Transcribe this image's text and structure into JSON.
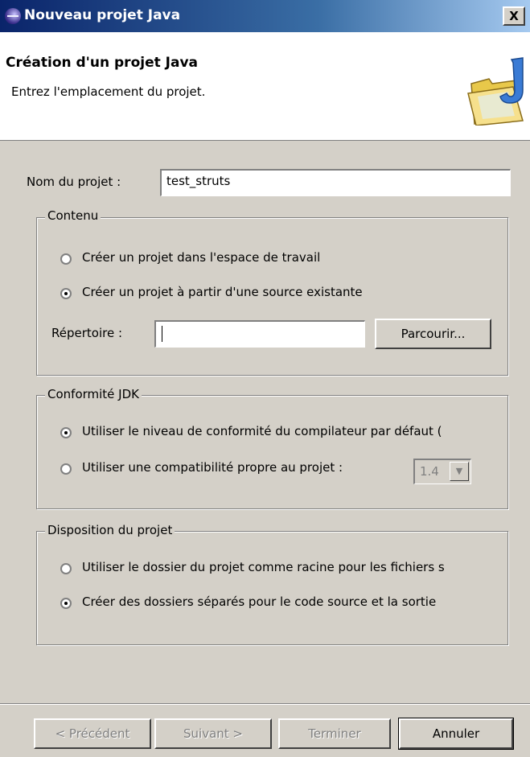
{
  "window": {
    "title": "Nouveau projet Java",
    "close_label": "X"
  },
  "banner": {
    "title": "Création d'un projet Java",
    "description": "Entrez l'emplacement du projet."
  },
  "project_name": {
    "label": "Nom du projet :",
    "value": "test_struts"
  },
  "content_group": {
    "title": "Contenu",
    "option_workspace": "Créer un projet dans l'espace de travail",
    "option_existing": "Créer un projet à partir d'une source existante",
    "selected": "existing",
    "directory_label": "Répertoire :",
    "directory_value": "",
    "browse_label": "Parcourir..."
  },
  "jdk_group": {
    "title": "Conformité JDK",
    "option_default": "Utiliser le niveau de conformité du compilateur par défaut (",
    "option_project": "Utiliser une compatibilité propre au projet :",
    "selected": "default",
    "compliance_value": "1.4"
  },
  "layout_group": {
    "title": "Disposition du projet",
    "option_root": "Utiliser le dossier du projet comme racine pour les fichiers s",
    "option_separate": "Créer des dossiers séparés pour le code source et la sortie",
    "selected": "separate"
  },
  "buttons": {
    "previous": "< Précédent",
    "next": "Suivant >",
    "finish": "Terminer",
    "cancel": "Annuler"
  },
  "icons": {
    "title": "eclipse-icon",
    "banner": "java-project-folder-icon"
  }
}
